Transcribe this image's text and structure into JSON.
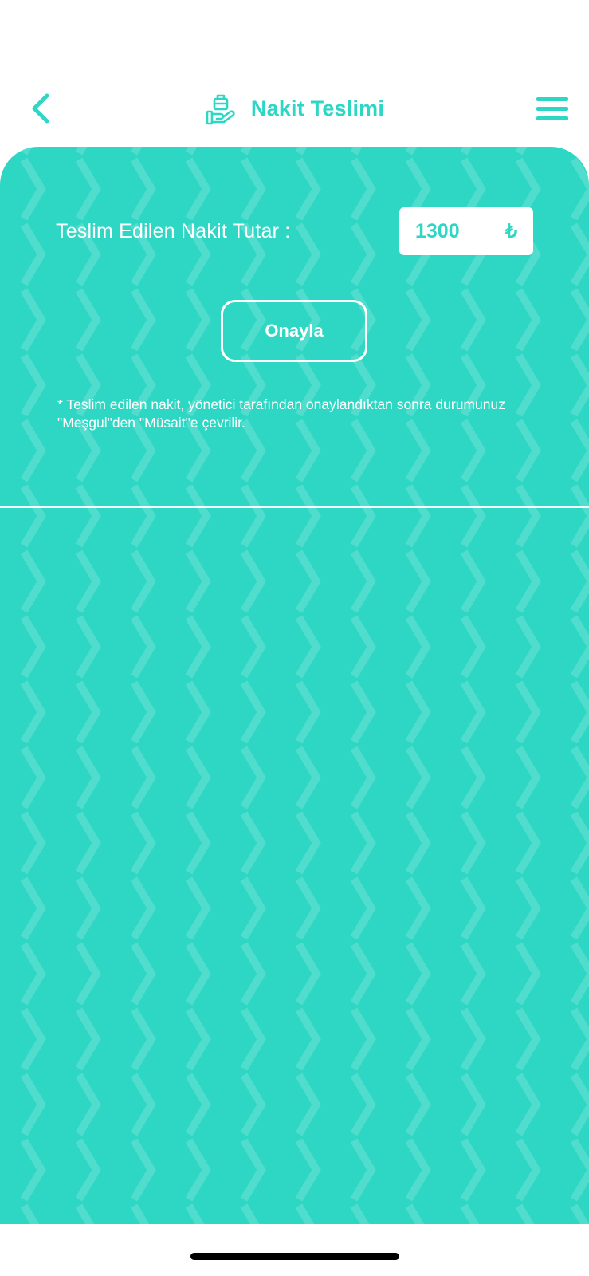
{
  "header": {
    "title": "Nakit Teslimi",
    "back_icon": "chevron-left-icon",
    "title_icon": "hand-holding-briefcase-icon",
    "menu_icon": "hamburger-menu-icon"
  },
  "form": {
    "amount_label": "Teslim Edilen Nakit Tutar :",
    "amount_value": "1300",
    "currency_symbol": "₺",
    "confirm_label": "Onayla",
    "note": "* Teslim edilen nakit, yönetici tarafından onaylandıktan sonra durumunuz \"Meşgul\"den \"Müsait\"e çevrilir."
  },
  "colors": {
    "accent": "#2ed6c4",
    "background": "#ffffff",
    "text_on_accent": "#ffffff"
  }
}
